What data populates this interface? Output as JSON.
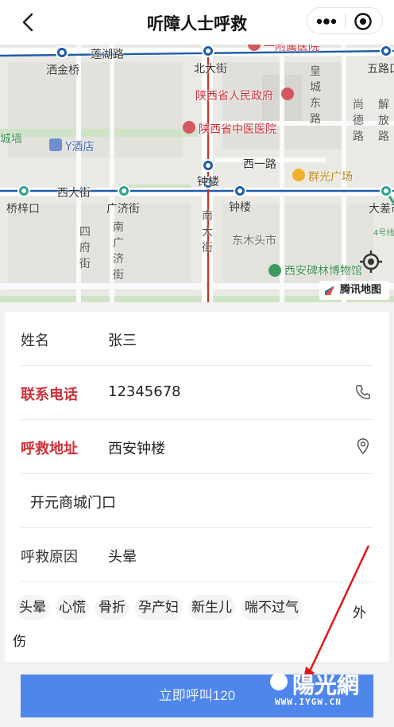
{
  "navbar": {
    "title": "听障人士呼救"
  },
  "map": {
    "labels": {
      "lianhu_road": "莲湖路",
      "affiliated_hospital": "一附属医院",
      "jiujinqiao": "洒金桥",
      "beidajie": "北大街",
      "wulukou": "五路口",
      "huangcheng_east": "皇城东路",
      "shangde_road": "尚德路",
      "jiefang_road": "解放路",
      "provincial_gov": "陕西省人民政府",
      "chengqiang": "城墙",
      "y_hotel": "Y酒店",
      "tcm_hospital": "陕西省中医医院",
      "xiyi_road": "西一路",
      "qunguang_plaza": "群光广场",
      "zhonglou_station": "钟楼",
      "xidajie": "西大街",
      "qiaozikou": "桥梓口",
      "guangjijie": "广济街",
      "zhonglou": "钟楼",
      "dachai": "大差市",
      "line4": "4号线",
      "sifujie": "四府街",
      "nanguangji": "南广济街",
      "nandajie": "南大街",
      "dongmutoushi": "东木头市",
      "beilin_museum": "西安碑林博物馆",
      "logo": "腾讯地图"
    }
  },
  "form": {
    "name": {
      "label": "姓名",
      "value": "张三"
    },
    "phone": {
      "label": "联系电话",
      "value": "12345678"
    },
    "address": {
      "label": "呼救地址",
      "value": "西安钟楼"
    },
    "detail": {
      "value": "开元商城门口"
    },
    "reason": {
      "label": "呼救原因",
      "value": "头晕"
    },
    "tags": [
      "头晕",
      "心慌",
      "骨折",
      "孕产妇",
      "新生儿",
      "喘不过气"
    ],
    "tag_last_part1": "外",
    "tag_last_part2": "伤"
  },
  "call_button": {
    "label": "立即呼叫120"
  },
  "watermark": {
    "big": "陽光網",
    "small": "WWW.IYGW.CN"
  },
  "colors": {
    "accent": "#4f86ec",
    "required_label": "#d0303a",
    "metro_line": "#1e5cab",
    "subway_red": "#c0392b"
  }
}
